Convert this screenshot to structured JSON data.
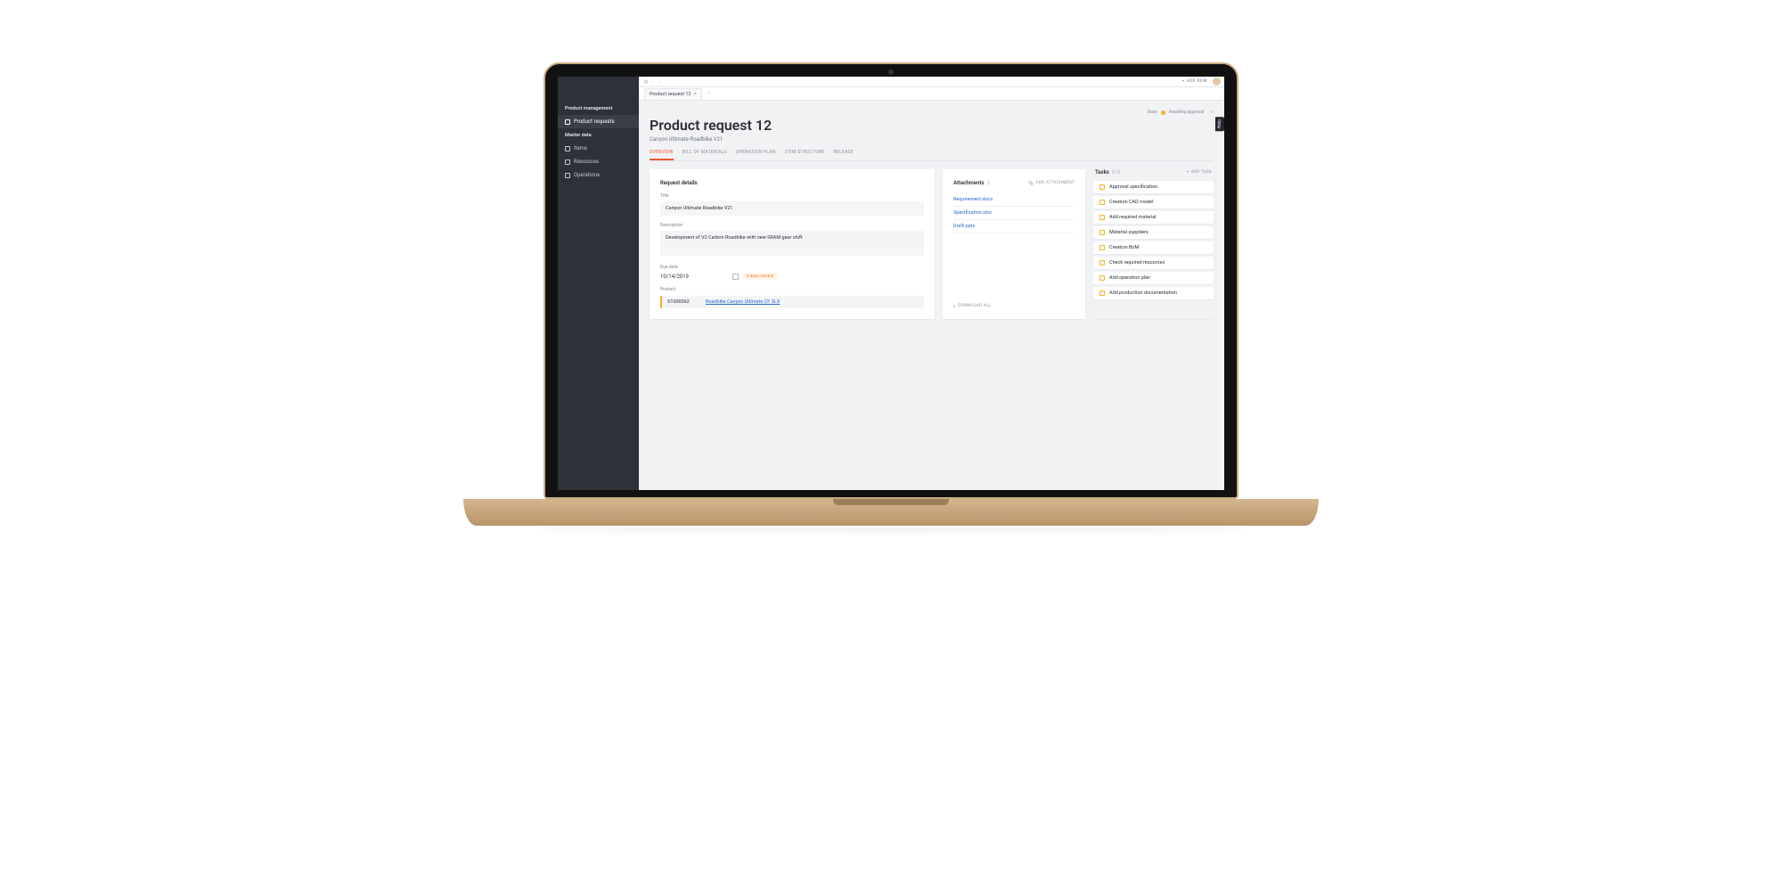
{
  "topbar": {
    "add_row": "ADD ROW"
  },
  "document_tab": {
    "title": "Product request 12"
  },
  "sidebar": {
    "section1": "Product management",
    "items1": [
      {
        "label": "Product requests",
        "active": true
      }
    ],
    "section2": "Master data",
    "items2": [
      {
        "label": "Items"
      },
      {
        "label": "Resources"
      },
      {
        "label": "Operations"
      }
    ]
  },
  "state": {
    "label": "State",
    "value": "Awaiting approval"
  },
  "page": {
    "title": "Product request 12",
    "subtitle": "Canyon Ultimate Roadbike V21"
  },
  "subtabs": [
    "OVERVIEW",
    "BILL OF MATERIALS",
    "OPERATION PLAN",
    "ITEM STRUCTURE",
    "RELEASE"
  ],
  "details": {
    "section": "Request details",
    "title_label": "Title",
    "title_value": "Canyon Ultimate Roadbike V21",
    "desc_label": "Description",
    "desc_value": "Development of V2 Carbon Roadbike with new SRAM gear shift",
    "due_label": "Due date",
    "due_value": "10/14/2019",
    "overdue": "6 days overdue",
    "product_label": "Product",
    "product_id": "S1000062",
    "product_name": "Roadbike Canyon Ultimate CF SLX"
  },
  "attachments": {
    "heading": "Attachments",
    "count": "3",
    "add": "ADD ATTACHMENT",
    "files": [
      "Requirement.docx",
      "Specification.xlsx",
      "Draft.pptx"
    ],
    "download_all": "DOWNLOAD ALL"
  },
  "tasks": {
    "heading": "Tasks",
    "count": "0/8",
    "add": "ADD TASK",
    "items": [
      "Approval specification",
      "Creation CAD model",
      "Add required material",
      "Material suppliers",
      "Creation BoM",
      "Check required resources",
      "Add operation plan",
      "Add production documentation"
    ]
  },
  "help": "Help"
}
